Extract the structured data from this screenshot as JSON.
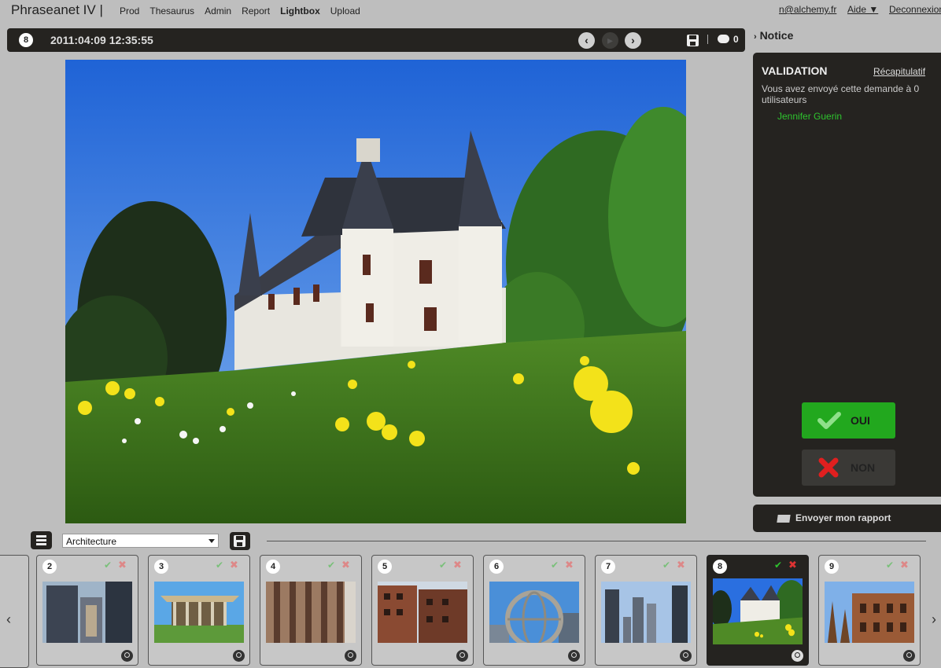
{
  "app": {
    "title": "Phraseanet IV |"
  },
  "menu": [
    {
      "label": "Prod"
    },
    {
      "label": "Thesaurus"
    },
    {
      "label": "Admin"
    },
    {
      "label": "Report"
    },
    {
      "label": "Lightbox",
      "active": true
    },
    {
      "label": "Upload"
    }
  ],
  "top_right": {
    "user": "n@alchemy.fr",
    "help": "Aide ▼",
    "logout": "Deconnexion"
  },
  "viewer": {
    "index": "8",
    "date": "2011:04:09 12:35:55",
    "comment_count": "0",
    "icons": [
      "chevron-left-icon",
      "play-icon",
      "chevron-right-icon",
      "save-icon",
      "comment-icon"
    ]
  },
  "notice": {
    "label": "Notice"
  },
  "validation": {
    "title": "VALIDATION",
    "recap": "Récapitulatif",
    "message": "Vous avez envoyé cette demande à 0 utilisateurs",
    "user": "Jennifer Guerin",
    "yes_label": "OUI",
    "no_label": "NON"
  },
  "report_button": {
    "label": "Envoyer mon rapport"
  },
  "basket": {
    "selected": "Architecture"
  },
  "thumbnails": [
    {
      "index": "2",
      "scene": "glass-towers"
    },
    {
      "index": "3",
      "scene": "pavilion"
    },
    {
      "index": "4",
      "scene": "facade"
    },
    {
      "index": "5",
      "scene": "brick-buildings"
    },
    {
      "index": "6",
      "scene": "unisphere"
    },
    {
      "index": "7",
      "scene": "skyscrapers"
    },
    {
      "index": "8",
      "scene": "castle",
      "selected": true
    },
    {
      "index": "9",
      "scene": "victorian"
    }
  ],
  "colors": {
    "dark_panel": "#252320",
    "accept_green": "#22a81e",
    "user_green": "#2ec42e",
    "background": "#bebebe"
  }
}
